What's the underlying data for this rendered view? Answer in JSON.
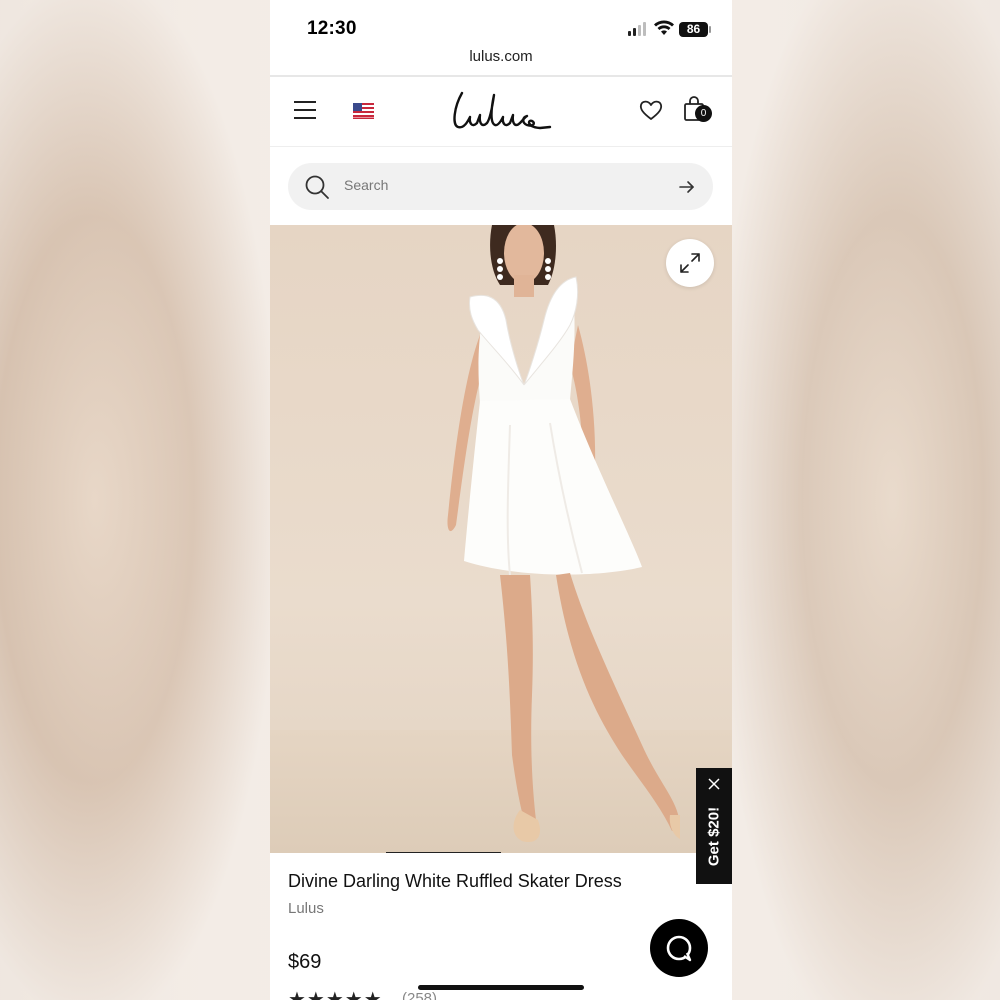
{
  "status_bar": {
    "time": "12:30",
    "battery": "86"
  },
  "browser": {
    "url": "lulus.com"
  },
  "header": {
    "logo_text": "Lulus",
    "bag_count": "0"
  },
  "search": {
    "placeholder": "Search"
  },
  "gallery": {
    "current_image": 1
  },
  "promo": {
    "label": "Get $20!"
  },
  "product": {
    "title": "Divine Darling White Ruffled Skater Dress",
    "brand": "Lulus",
    "price": "$69",
    "rating_stars": "★★★★★",
    "rating_count": "(258)"
  },
  "colors": {
    "accent": "#111111",
    "image_bg": "#e6d5c4"
  }
}
